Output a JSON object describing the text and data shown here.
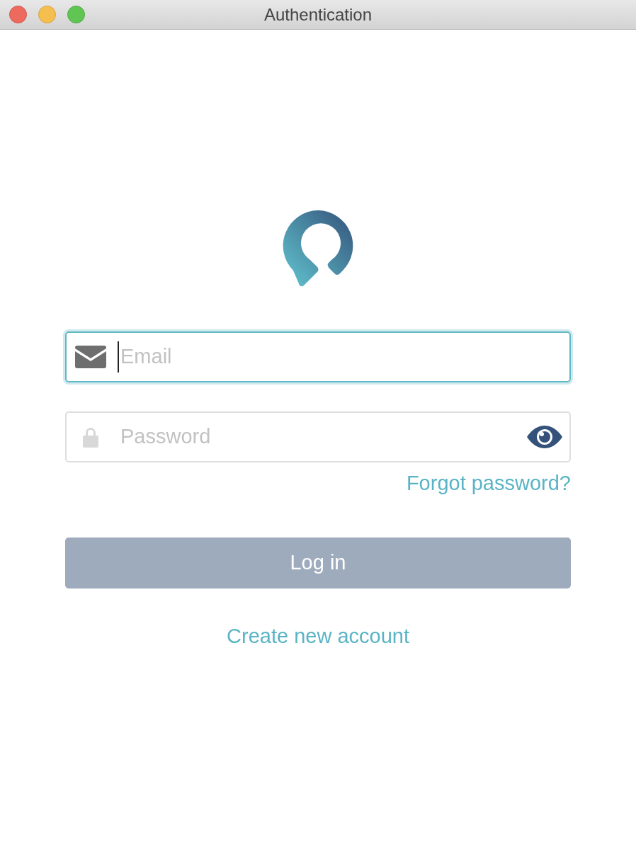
{
  "window": {
    "title": "Authentication"
  },
  "fields": [
    {
      "kind": "email",
      "placeholder": "Email",
      "focused": true
    },
    {
      "kind": "password",
      "placeholder": "Password",
      "focused": false
    }
  ],
  "forgot_link": "Forgot password?",
  "login_button": {
    "label": "Log in",
    "disabled": true
  },
  "create_link": "Create new account"
}
